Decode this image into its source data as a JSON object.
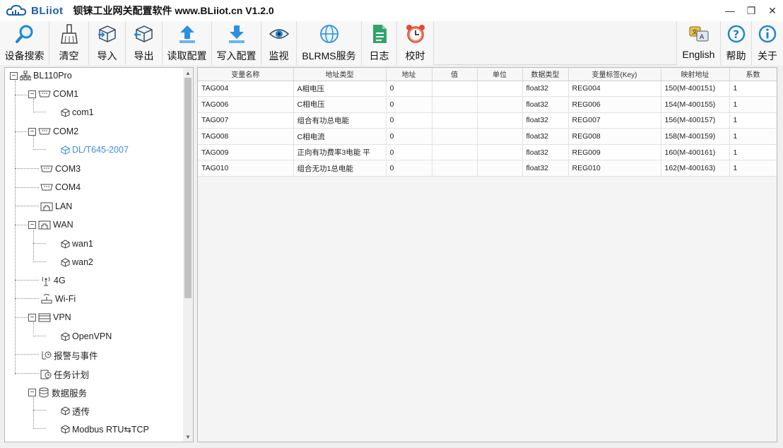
{
  "window": {
    "logo_text": "BLiiot",
    "title": "钡铼工业网关配置软件 www.BLiiot.cn V1.2.0",
    "controls": {
      "minimize": "—",
      "maximize": "❐",
      "close": "✕"
    }
  },
  "toolbar": {
    "left": [
      {
        "label": "设备搜索",
        "icon": "search-icon"
      },
      {
        "label": "清空",
        "icon": "broom-icon"
      },
      {
        "label": "导入",
        "icon": "import-cube-icon"
      },
      {
        "label": "导出",
        "icon": "export-cube-icon"
      },
      {
        "label": "读取配置",
        "icon": "upload-arrow-icon"
      },
      {
        "label": "写入配置",
        "icon": "download-arrow-icon"
      },
      {
        "label": "监视",
        "icon": "eye-icon"
      },
      {
        "label": "BLRMS服务",
        "icon": "globe-icon"
      },
      {
        "label": "日志",
        "icon": "log-document-icon"
      },
      {
        "label": "校时",
        "icon": "alarm-clock-icon"
      }
    ],
    "right": [
      {
        "label": "English",
        "icon": "language-icon"
      },
      {
        "label": "帮助",
        "icon": "help-icon"
      },
      {
        "label": "关于",
        "icon": "info-icon"
      }
    ]
  },
  "tree": {
    "root": "BL110Pro",
    "com1": "COM1",
    "com1_child": "com1",
    "com2": "COM2",
    "com2_child": "DL/T645-2007",
    "com3": "COM3",
    "com4": "COM4",
    "lan": "LAN",
    "wan": "WAN",
    "wan1": "wan1",
    "wan2": "wan2",
    "g4": "4G",
    "wifi": "Wi-Fi",
    "vpn": "VPN",
    "openvpn": "OpenVPN",
    "alarm": "报警与事件",
    "task": "任务计划",
    "data_service": "数据服务",
    "passthrough": "透传",
    "modbus": "Modbus RTU⇆TCP"
  },
  "table": {
    "headers": [
      "变量名称",
      "地址类型",
      "地址",
      "值",
      "单位",
      "数据类型",
      "变量标签(Key)",
      "映射地址",
      "系数"
    ],
    "rows": [
      [
        "TAG004",
        "A相电压",
        "0",
        "",
        "",
        "float32",
        "REG004",
        "150(M-400151)",
        "1"
      ],
      [
        "TAG006",
        "C相电压",
        "0",
        "",
        "",
        "float32",
        "REG006",
        "154(M-400155)",
        "1"
      ],
      [
        "TAG007",
        "组合有功总电能",
        "0",
        "",
        "",
        "float32",
        "REG007",
        "156(M-400157)",
        "1"
      ],
      [
        "TAG008",
        "C相电流",
        "0",
        "",
        "",
        "float32",
        "REG008",
        "158(M-400159)",
        "1"
      ],
      [
        "TAG009",
        "正向有功费率3电能 平",
        "0",
        "",
        "",
        "float32",
        "REG009",
        "160(M-400161)",
        "1"
      ],
      [
        "TAG010",
        "组合无功1总电能",
        "0",
        "",
        "",
        "float32",
        "REG010",
        "162(M-400163)",
        "1"
      ]
    ]
  },
  "colors": {
    "accent": "#1a5db5",
    "selected_node": "#3a8ee6"
  }
}
